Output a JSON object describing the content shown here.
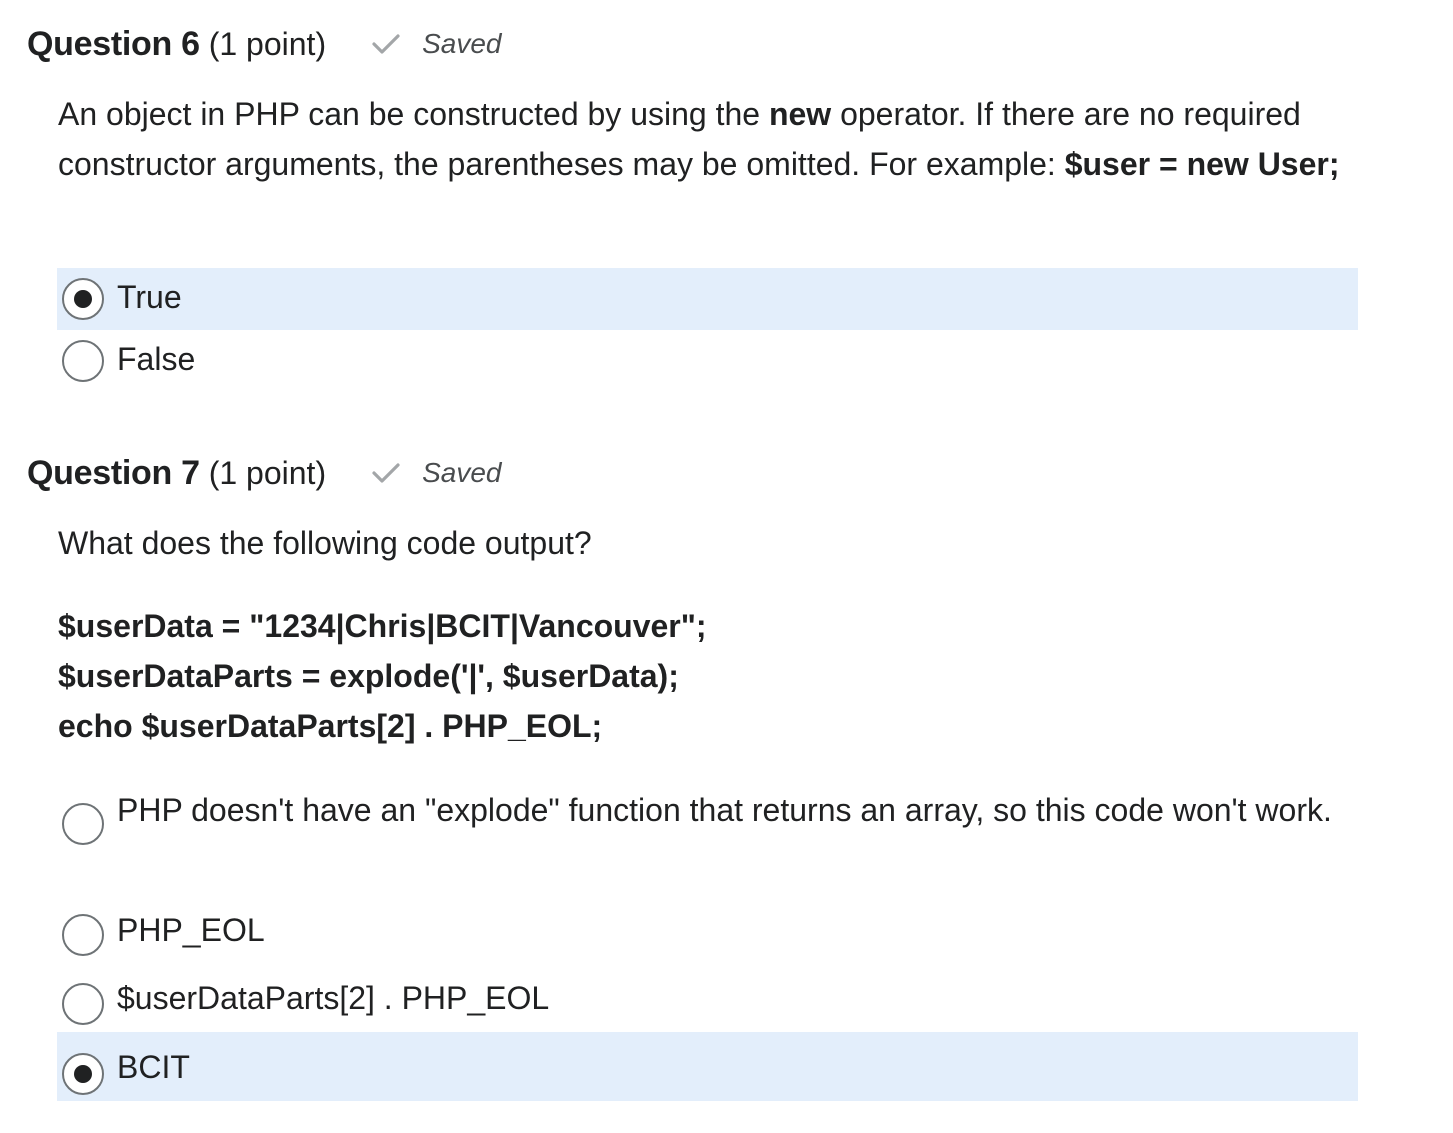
{
  "questions": [
    {
      "title": "Question 6",
      "points": "(1 point)",
      "status": "Saved",
      "prompt": {
        "part1": "An object in PHP can be constructed by using the ",
        "bold1": "new",
        "part2": " operator. If there are no required constructor arguments, the parentheses may be omitted. For example: ",
        "bold2": "$user = new User;"
      },
      "choices": [
        {
          "label": "True",
          "selected": true
        },
        {
          "label": "False",
          "selected": false
        }
      ]
    },
    {
      "title": "Question 7",
      "points": "(1 point)",
      "status": "Saved",
      "prompt_text": "What does the following code output?",
      "code_lines": [
        "$userData = \"1234|Chris|BCIT|Vancouver\";",
        "$userDataParts = explode('|', $userData);",
        "echo $userDataParts[2] . PHP_EOL;"
      ],
      "choices": [
        {
          "label": "PHP doesn't have an \"explode\" function that returns an array, so this code won't work.",
          "selected": false
        },
        {
          "label": "PHP_EOL",
          "selected": false
        },
        {
          "label": "$userDataParts[2] . PHP_EOL",
          "selected": false
        },
        {
          "label": "BCIT",
          "selected": true
        }
      ]
    }
  ],
  "icons": {
    "saved": "checkmark-icon",
    "radio_selected": "radio-selected-icon",
    "radio_empty": "radio-empty-icon"
  },
  "colors": {
    "selected_row_bg": "#e3eefb",
    "text": "#202122",
    "muted": "#494c4e",
    "check": "#a3a6a8"
  }
}
